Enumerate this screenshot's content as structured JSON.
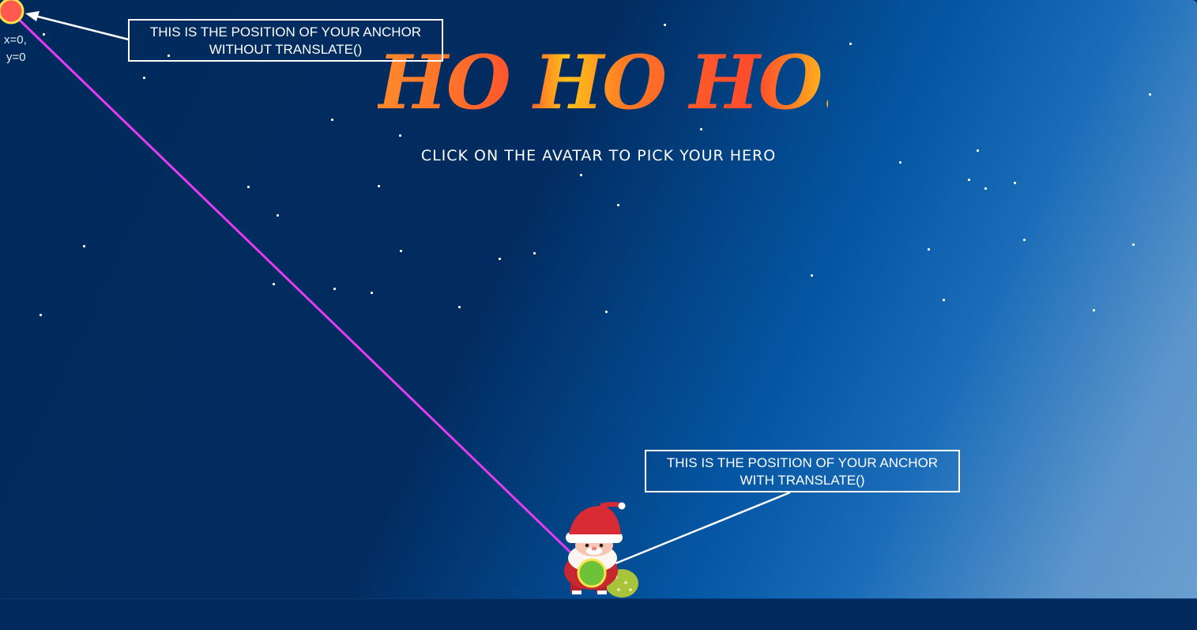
{
  "title": "HO HO HO!",
  "subtitle": "CLICK ON THE AVATAR TO PICK YOUR HERO",
  "annotations": {
    "top_line1": "THIS IS THE POSITION OF YOUR ANCHOR",
    "top_line2": "WITHOUT TRANSLATE()",
    "bottom_line1": "THIS IS THE POSITION OF YOUR ANCHOR",
    "bottom_line2": "WITH TRANSLATE()",
    "origin_x": "x=0,",
    "origin_y": "y=0"
  },
  "colors": {
    "anchor_origin": "#ff4d4d",
    "anchor_origin_ring": "#ffe24a",
    "anchor_translated": "#6dc23a",
    "anchor_translated_ring": "#ffe24a",
    "connector_line": "#e33cf0"
  },
  "avatar": {
    "icon": "santa-avatar-icon"
  }
}
